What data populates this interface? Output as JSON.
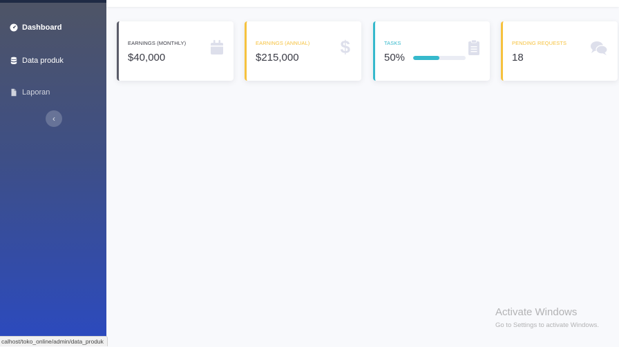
{
  "sidebar": {
    "items": [
      {
        "label": "Dashboard",
        "icon": "dashboard-icon"
      },
      {
        "label": "Data produk",
        "icon": "database-icon"
      },
      {
        "label": "Laporan",
        "icon": "document-icon"
      }
    ],
    "toggle_glyph": "‹"
  },
  "cards": [
    {
      "label": "EARNINGS (MONTHLY)",
      "value": "$40,000",
      "icon": "calendar-icon",
      "accent": "#5a5c69"
    },
    {
      "label": "EARNINGS (ANNUAL)",
      "value": "$215,000",
      "icon": "dollar-icon",
      "accent": "#f6c23e"
    },
    {
      "label": "TASKS",
      "value": "50%",
      "progress": 0.5,
      "icon": "clipboard-icon",
      "accent": "#36b9cc"
    },
    {
      "label": "PENDING REQUESTS",
      "value": "18",
      "icon": "comments-icon",
      "accent": "#f6c23e"
    }
  ],
  "watermark": {
    "title": "Activate Windows",
    "subtitle": "Go to Settings to activate Windows."
  },
  "status_url": "calhost/toko_online/admin/data_produk"
}
